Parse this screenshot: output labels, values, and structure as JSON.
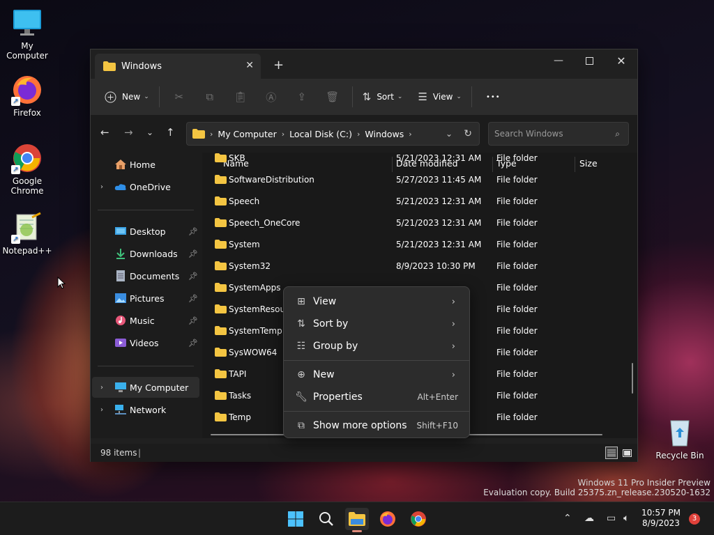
{
  "desktop": {
    "icons": [
      {
        "label": "My Computer"
      },
      {
        "label": "Firefox"
      },
      {
        "label": "Google Chrome"
      },
      {
        "label": "Notepad++"
      },
      {
        "label": "Recycle Bin"
      }
    ],
    "watermark_line1": "Windows 11 Pro Insider Preview",
    "watermark_line2": "Evaluation copy. Build 25375.zn_release.230520-1632"
  },
  "window": {
    "tab_title": "Windows",
    "new_tab_symbol": "+",
    "toolbar": {
      "new_label": "New",
      "sort_label": "Sort",
      "view_label": "View",
      "more_label": "•••"
    },
    "address": {
      "crumbs": [
        "My Computer",
        "Local Disk (C:)",
        "Windows"
      ]
    },
    "search": {
      "placeholder": "Search Windows"
    },
    "sidebar": {
      "items": [
        {
          "label": "Home"
        },
        {
          "label": "OneDrive"
        },
        {
          "label": "Desktop"
        },
        {
          "label": "Downloads"
        },
        {
          "label": "Documents"
        },
        {
          "label": "Pictures"
        },
        {
          "label": "Music"
        },
        {
          "label": "Videos"
        },
        {
          "label": "My Computer"
        },
        {
          "label": "Network"
        }
      ]
    },
    "columns": {
      "name": "Name",
      "date": "Date modified",
      "type": "Type",
      "size": "Size"
    },
    "rows": [
      {
        "name": "SKB",
        "date": "5/21/2023 12:31 AM",
        "type": "File folder"
      },
      {
        "name": "SoftwareDistribution",
        "date": "5/27/2023 11:45 AM",
        "type": "File folder"
      },
      {
        "name": "Speech",
        "date": "5/21/2023 12:31 AM",
        "type": "File folder"
      },
      {
        "name": "Speech_OneCore",
        "date": "5/21/2023 12:31 AM",
        "type": "File folder"
      },
      {
        "name": "System",
        "date": "5/21/2023 12:31 AM",
        "type": "File folder"
      },
      {
        "name": "System32",
        "date": "8/9/2023 10:30 PM",
        "type": "File folder"
      },
      {
        "name": "SystemApps",
        "date": "",
        "type": "File folder"
      },
      {
        "name": "SystemResources",
        "date": "",
        "type": "File folder"
      },
      {
        "name": "SystemTemp",
        "date": "",
        "type": "File folder"
      },
      {
        "name": "SysWOW64",
        "date": "",
        "type": "File folder"
      },
      {
        "name": "TAPI",
        "date": "",
        "type": "File folder"
      },
      {
        "name": "Tasks",
        "date": "",
        "type": "File folder"
      },
      {
        "name": "Temp",
        "date": "",
        "type": "File folder"
      }
    ],
    "status": {
      "item_count": "98 items"
    }
  },
  "context_menu": {
    "items": [
      {
        "label": "View",
        "shortcut": ""
      },
      {
        "label": "Sort by",
        "shortcut": ""
      },
      {
        "label": "Group by",
        "shortcut": ""
      },
      {
        "label": "New",
        "shortcut": ""
      },
      {
        "label": "Properties",
        "shortcut": "Alt+Enter"
      },
      {
        "label": "Show more options",
        "shortcut": "Shift+F10"
      }
    ]
  },
  "taskbar": {
    "time": "10:57 PM",
    "date": "8/9/2023",
    "notification_count": "3"
  },
  "colors": {
    "folder": "#f4c542",
    "accent": "#4cc2ff",
    "badge": "#e0413a"
  }
}
